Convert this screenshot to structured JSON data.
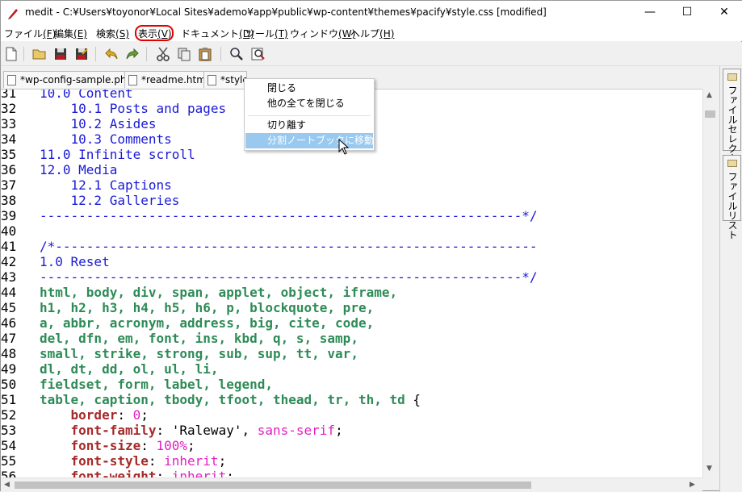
{
  "window": {
    "title": "medit - C:¥Users¥toyonor¥Local Sites¥ademo¥app¥public¥wp-content¥themes¥pacify¥style.css [modified]",
    "controls": {
      "minimize": "—",
      "maximize": "☐",
      "close": "✕"
    }
  },
  "menu": [
    {
      "label": "ファイル",
      "key": "(F)"
    },
    {
      "label": "編集",
      "key": "(E)"
    },
    {
      "label": "検索",
      "key": "(S)"
    },
    {
      "label": "表示",
      "key": "(V)"
    },
    {
      "label": "ドキュメント",
      "key": "(D)"
    },
    {
      "label": "ツール",
      "key": "(T)"
    },
    {
      "label": "ウィンドウ",
      "key": "(W)"
    },
    {
      "label": "ヘルプ",
      "key": "(H)"
    }
  ],
  "tabs": [
    {
      "label": "*wp-config-sample.php"
    },
    {
      "label": "*readme.html"
    },
    {
      "label": "*style.css"
    }
  ],
  "context_menu": {
    "items": [
      "閉じる",
      "他の全てを閉じる",
      "切り離す",
      "分割ノートブックに移動"
    ],
    "highlighted": "分割ノートブックに移動"
  },
  "side_panel": {
    "tabs": [
      "ファイルセレクター",
      "ファイルリスト"
    ]
  },
  "editor": {
    "lines": [
      {
        "n": "31",
        "segs": [
          [
            "c-comment",
            "10.0 Content"
          ]
        ]
      },
      {
        "n": "32",
        "segs": [
          [
            "c-comment",
            "    10.1 Posts and pages"
          ]
        ]
      },
      {
        "n": "33",
        "segs": [
          [
            "c-comment",
            "    10.2 Asides"
          ]
        ]
      },
      {
        "n": "34",
        "segs": [
          [
            "c-comment",
            "    10.3 Comments"
          ]
        ]
      },
      {
        "n": "35",
        "segs": [
          [
            "c-comment",
            "11.0 Infinite scroll"
          ]
        ]
      },
      {
        "n": "36",
        "segs": [
          [
            "c-comment",
            "12.0 Media"
          ]
        ]
      },
      {
        "n": "37",
        "segs": [
          [
            "c-comment",
            "    12.1 Captions"
          ]
        ]
      },
      {
        "n": "38",
        "segs": [
          [
            "c-comment",
            "    12.2 Galleries"
          ]
        ]
      },
      {
        "n": "39",
        "segs": [
          [
            "c-comment",
            "--------------------------------------------------------------*/"
          ]
        ]
      },
      {
        "n": "40",
        "segs": []
      },
      {
        "n": "41",
        "segs": [
          [
            "c-comment",
            "/*--------------------------------------------------------------"
          ]
        ]
      },
      {
        "n": "42",
        "segs": [
          [
            "c-comment",
            "1.0 Reset"
          ]
        ]
      },
      {
        "n": "43",
        "segs": [
          [
            "c-comment",
            "--------------------------------------------------------------*/"
          ]
        ]
      },
      {
        "n": "44",
        "segs": [
          [
            "c-sel",
            "html, body, div, span, applet, object, iframe,"
          ]
        ]
      },
      {
        "n": "45",
        "segs": [
          [
            "c-sel",
            "h1, h2, h3, h4, h5, h6, p, blockquote, pre,"
          ]
        ]
      },
      {
        "n": "46",
        "segs": [
          [
            "c-sel",
            "a, abbr, acronym, address, big, cite, code,"
          ]
        ]
      },
      {
        "n": "47",
        "segs": [
          [
            "c-sel",
            "del, dfn, em, font, ins, kbd, q, s, samp,"
          ]
        ]
      },
      {
        "n": "48",
        "segs": [
          [
            "c-sel",
            "small, strike, strong, sub, sup, tt, var,"
          ]
        ]
      },
      {
        "n": "49",
        "segs": [
          [
            "c-sel",
            "dl, dt, dd, ol, ul, li,"
          ]
        ]
      },
      {
        "n": "50",
        "segs": [
          [
            "c-sel",
            "fieldset, form, label, legend,"
          ]
        ]
      },
      {
        "n": "51",
        "segs": [
          [
            "c-sel",
            "table, caption, tbody, tfoot, thead, tr, th, td"
          ],
          [
            "c-punc",
            " {"
          ]
        ]
      },
      {
        "n": "52",
        "segs": [
          [
            "c-prop",
            "    border"
          ],
          [
            "c-punc",
            ": "
          ],
          [
            "c-val",
            "0"
          ],
          [
            "c-punc",
            ";"
          ]
        ]
      },
      {
        "n": "53",
        "segs": [
          [
            "c-prop",
            "    font-family"
          ],
          [
            "c-punc",
            ": 'Raleway', "
          ],
          [
            "c-val",
            "sans-serif"
          ],
          [
            "c-punc",
            ";"
          ]
        ]
      },
      {
        "n": "54",
        "segs": [
          [
            "c-prop",
            "    font-size"
          ],
          [
            "c-punc",
            ": "
          ],
          [
            "c-val",
            "100%"
          ],
          [
            "c-punc",
            ";"
          ]
        ]
      },
      {
        "n": "55",
        "segs": [
          [
            "c-prop",
            "    font-style"
          ],
          [
            "c-punc",
            ": "
          ],
          [
            "c-val",
            "inherit"
          ],
          [
            "c-punc",
            ";"
          ]
        ]
      },
      {
        "n": "56",
        "segs": [
          [
            "c-prop",
            "    font-weight"
          ],
          [
            "c-punc",
            ": "
          ],
          [
            "c-val",
            "inherit"
          ],
          [
            "c-punc",
            ";"
          ]
        ]
      }
    ]
  }
}
